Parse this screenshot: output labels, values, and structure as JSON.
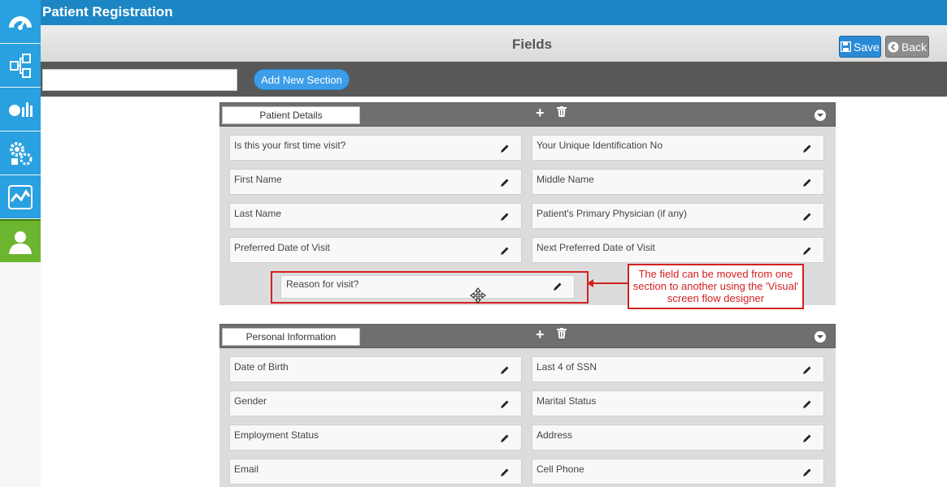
{
  "app": {
    "title": "Patient Registration"
  },
  "sidebar": {
    "items": [
      {
        "icon": "dashboard-icon"
      },
      {
        "icon": "workflow-icon"
      },
      {
        "icon": "analytics-icon"
      },
      {
        "icon": "settings-icon"
      },
      {
        "icon": "chart-icon"
      },
      {
        "icon": "user-icon"
      }
    ]
  },
  "header": {
    "title": "Fields",
    "save_label": "Save",
    "back_label": "Back"
  },
  "toolbar": {
    "section_input_value": "",
    "add_section_label": "Add New Section"
  },
  "sections": [
    {
      "name": "Patient Details",
      "fields": [
        "Is this your first time visit?",
        "Your Unique Identification No",
        "First Name",
        "Middle Name",
        "Last Name",
        "Patient's Primary Physician (if any)",
        "Preferred Date of Visit",
        "Next Preferred Date of Visit"
      ]
    },
    {
      "name": "Personal Information",
      "fields": [
        "Date of Birth",
        "Last 4 of SSN",
        "Gender",
        "Marital Status",
        "Employment Status",
        "Address",
        "Email",
        "Cell Phone"
      ]
    }
  ],
  "dragged_field": {
    "label": "Reason for visit?"
  },
  "callout": {
    "text": "The field can be moved from one section to another using the 'Visual' screen flow designer"
  },
  "colors": {
    "title_bar": "#1c86c5",
    "sidebar_blue": "#29a0df",
    "sidebar_active": "#6cb52f",
    "annotation_red": "#d42020"
  }
}
